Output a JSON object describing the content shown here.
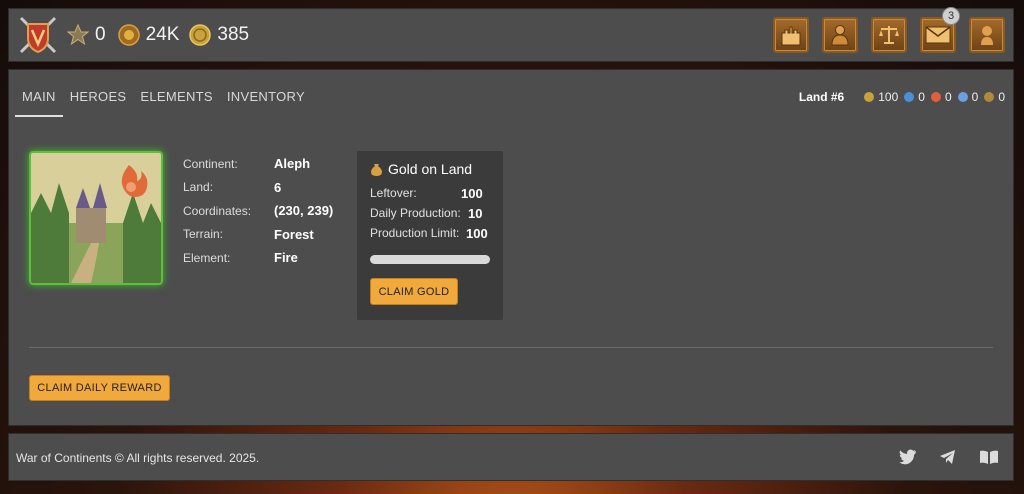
{
  "header": {
    "resources": [
      {
        "name": "vip",
        "icon": "vip-star-icon",
        "value": "0"
      },
      {
        "name": "gold",
        "icon": "gold-coin-icon",
        "value": "24K"
      },
      {
        "name": "token",
        "icon": "token-coin-icon",
        "value": "385"
      }
    ],
    "nav_icons": [
      "castle-icon",
      "knight-icon",
      "scales-icon",
      "mail-icon",
      "profile-icon"
    ],
    "mail_badge": "3"
  },
  "tabs": [
    "MAIN",
    "HEROES",
    "ELEMENTS",
    "INVENTORY"
  ],
  "active_tab": "MAIN",
  "land_summary": {
    "title": "Land #6",
    "items": [
      {
        "icon": "gold-icon",
        "value": "100",
        "color": "#c8a23a"
      },
      {
        "icon": "water-icon",
        "value": "0",
        "color": "#4a8fd8"
      },
      {
        "icon": "fire-icon",
        "value": "0",
        "color": "#e0603a"
      },
      {
        "icon": "air-icon",
        "value": "0",
        "color": "#6aa0e0"
      },
      {
        "icon": "earth-icon",
        "value": "0",
        "color": "#b08a3a"
      }
    ]
  },
  "details": [
    {
      "label": "Continent:",
      "value": "Aleph"
    },
    {
      "label": "Land:",
      "value": "6"
    },
    {
      "label": "Coordinates:",
      "value": "(230, 239)"
    },
    {
      "label": "Terrain:",
      "value": "Forest"
    },
    {
      "label": "Element:",
      "value": "Fire"
    }
  ],
  "gold_box": {
    "title": "Gold on Land",
    "rows": [
      {
        "label": "Leftover:",
        "value": "100"
      },
      {
        "label": "Daily Production:",
        "value": "10"
      },
      {
        "label": "Production Limit:",
        "value": "100"
      }
    ],
    "progress_fraction": 0,
    "claim_label": "CLAIM GOLD"
  },
  "claim_daily_label": "CLAIM DAILY REWARD",
  "footer": {
    "copyright": "War of Continents © All rights reserved. 2025.",
    "social": [
      "twitter-icon",
      "telegram-icon",
      "book-icon"
    ]
  },
  "colors": {
    "accent": "#f2a93b",
    "panel": "#4d4d4d",
    "land_glow": "#5fbf3a"
  }
}
